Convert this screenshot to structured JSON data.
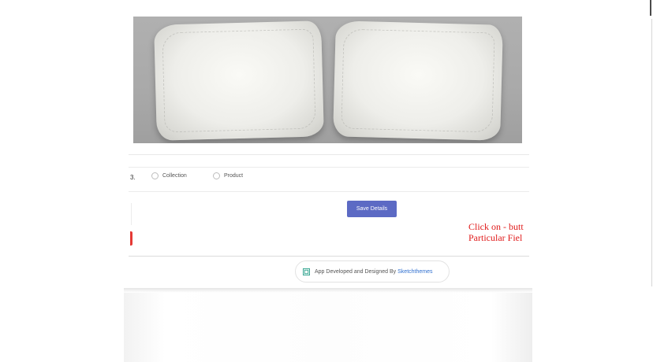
{
  "type_selector": {
    "row_number": "3.",
    "options": [
      {
        "label": "Collection",
        "selected": false
      },
      {
        "label": "Product",
        "selected": false
      }
    ]
  },
  "actions": {
    "save_label": "Save Details"
  },
  "hint": {
    "line1": "Click on - butt",
    "line2": "Particular Fiel"
  },
  "footer": {
    "credit_text": "App Developed and Designed By",
    "credit_link": "Sketchthemes"
  },
  "icons": {
    "radio_empty": "radio-empty-icon",
    "credit_logo": "sketchthemes-logo-icon"
  },
  "colors": {
    "primary_button": "#5c6ac4",
    "hint_text": "#e01b1b",
    "link": "#2f6fcf",
    "marker": "#e53935"
  }
}
